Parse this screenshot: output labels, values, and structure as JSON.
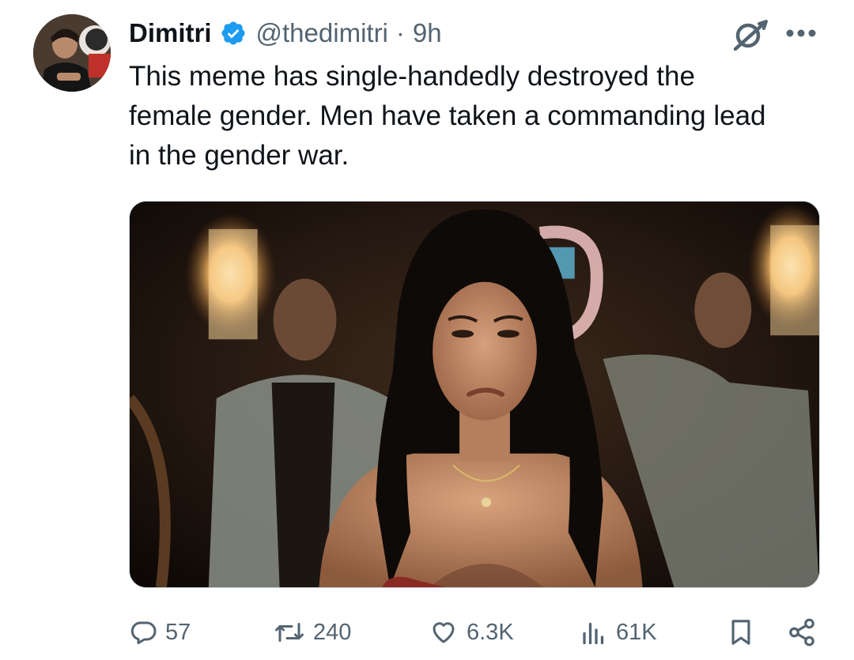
{
  "author": {
    "display_name": "Dimitri",
    "handle": "@thedimitri",
    "separator": "·",
    "time": "9h",
    "verified": true,
    "verified_color": "#1d9bf0"
  },
  "tweet": {
    "text_lines": [
      "This meme has single-handedly destroyed the",
      "female gender. Men have taken a commanding lead",
      "in the gender war."
    ]
  },
  "stats": {
    "replies": "57",
    "retweets": "240",
    "likes": "6.3K",
    "views": "61K"
  },
  "icons": {
    "grok": "grok-icon",
    "more": "more-icon",
    "reply": "reply-icon",
    "retweet": "retweet-icon",
    "like": "heart-icon",
    "views": "views-icon",
    "bookmark": "bookmark-icon",
    "share": "share-icon"
  },
  "colors": {
    "text_primary": "#0f1419",
    "text_secondary": "#536471"
  }
}
